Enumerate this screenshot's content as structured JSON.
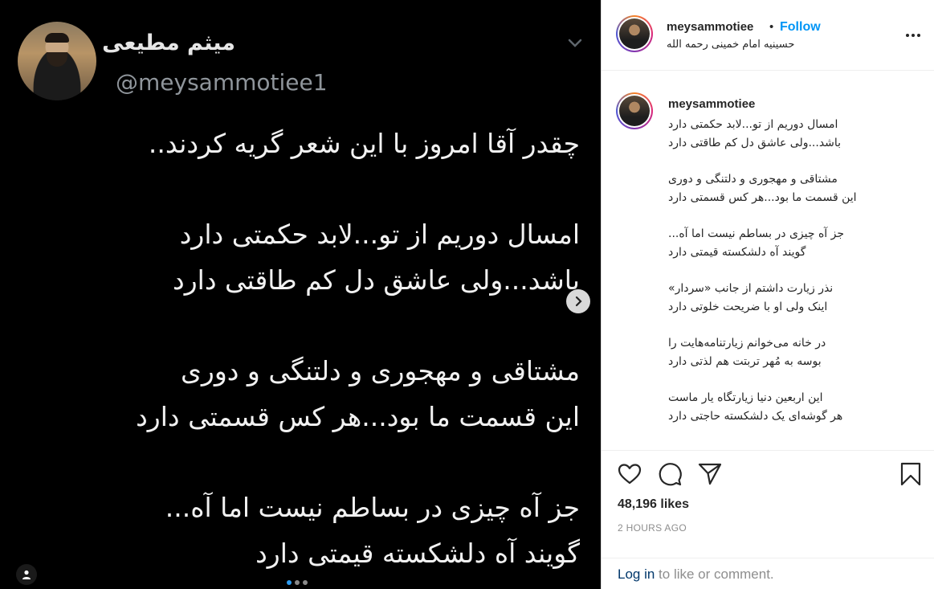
{
  "tweet": {
    "name": "میثم مطیعی",
    "handle": "@meysammotiee1",
    "lines": [
      "چقدر آقا امروز با این شعر گریه کردند..",
      "",
      "امسال دوریم از تو...لابد حکمتی دارد",
      "باشد...ولی عاشق دل کم طاقتی دارد",
      "",
      "مشتاقی و مهجوری و دلتنگی و دوری",
      "این قسمت ما بود...هر کس قسمتی دارد",
      "",
      "جز آه چیزی در بساطم نیست اما آه...",
      "گویند آه دلشکسته قیمتی دارد"
    ]
  },
  "carousel": {
    "count": 3,
    "active": 0
  },
  "post_header": {
    "username": "meysammotiee",
    "separator": "•",
    "follow_label": "Follow",
    "location": "حسینیه امام خمینی رحمه الله"
  },
  "caption": {
    "username": "meysammotiee",
    "stanzas": [
      [
        "امسال دوریم از تو...لابد حکمتی دارد",
        "باشد...ولی عاشق دل کم طاقتی دارد"
      ],
      [
        "مشتاقی و مهجوری و دلتنگی و دوری",
        "این قسمت ما بود...هر کس قسمتی دارد"
      ],
      [
        "جز آه چیزی در بساطم نیست اما آه...",
        "گویند آه دلشکسته قیمتی دارد"
      ],
      [
        "نذر زیارت داشتم از جانب «سردار»",
        "اینک ولی او با ضریحت خلوتی دارد"
      ],
      [
        "در خانه می‌خوانم زیارتنامه‌هایت را",
        "بوسه به مُهر تربتت هم لذتی دارد"
      ],
      [
        "این اربعین دنیا زیارتگاه یار ماست",
        "هر گوشه‌ای یک دلشکسته حاجتی دارد"
      ]
    ]
  },
  "stats": {
    "likes": "48,196 likes",
    "time_ago": "2 HOURS AGO"
  },
  "login": {
    "link": "Log in",
    "rest": " to like or comment."
  },
  "icons": {
    "heart": "heart-icon",
    "comment": "comment-icon",
    "share": "share-icon",
    "save": "bookmark-icon",
    "more": "more-icon",
    "next": "chevron-right-icon",
    "tag": "user-tag-icon"
  },
  "colors": {
    "accent": "#0095f6",
    "link": "#00376b",
    "muted": "#8e8e8e"
  }
}
